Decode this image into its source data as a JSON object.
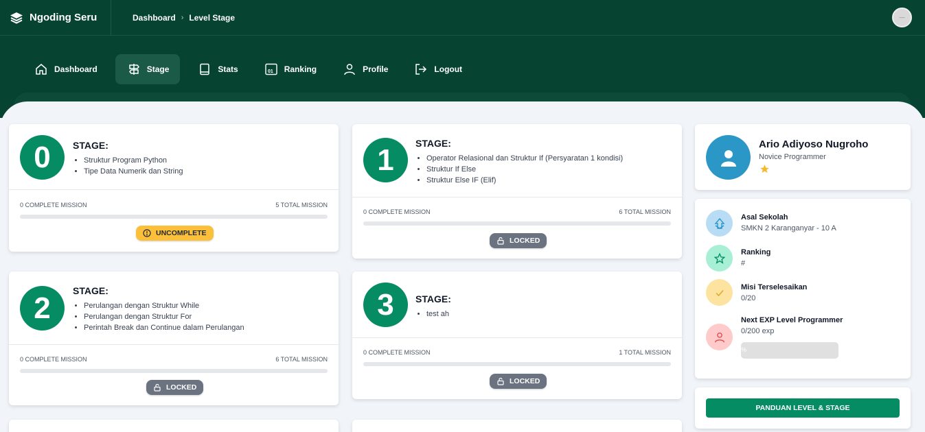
{
  "app": {
    "name": "Ngoding Seru"
  },
  "breadcrumb": {
    "items": [
      "Dashboard",
      "Level Stage"
    ],
    "separator": "›"
  },
  "nav": {
    "items": [
      {
        "label": "Dashboard",
        "icon": "home-icon"
      },
      {
        "label": "Stage",
        "icon": "signpost-icon",
        "active": true
      },
      {
        "label": "Stats",
        "icon": "book-icon"
      },
      {
        "label": "Ranking",
        "icon": "ranking-icon"
      },
      {
        "label": "Profile",
        "icon": "user-icon"
      },
      {
        "label": "Logout",
        "icon": "logout-icon"
      }
    ]
  },
  "stages": [
    {
      "number": "0",
      "title": "STAGE:",
      "topics": [
        "Struktur Program Python",
        "Tipe Data Numerik dan String"
      ],
      "complete": "0 COMPLETE MISSION",
      "total": "5 TOTAL MISSION",
      "progress": 0,
      "status": "UNCOMPLETE",
      "status_icon": "alert-circle-icon"
    },
    {
      "number": "1",
      "title": "STAGE:",
      "topics": [
        "Operator Relasional dan Struktur If (Persyaratan 1 kondisi)",
        "Struktur If Else",
        "Struktur Else IF (Elif)"
      ],
      "complete": "0 COMPLETE MISSION",
      "total": "6 TOTAL MISSION",
      "progress": 0,
      "status": "LOCKED",
      "status_icon": "lock-icon"
    },
    {
      "number": "2",
      "title": "STAGE:",
      "topics": [
        "Perulangan dengan Struktur While",
        "Perulangan dengan Struktur For",
        "Perintah Break dan Continue dalam Perulangan"
      ],
      "complete": "0 COMPLETE MISSION",
      "total": "6 TOTAL MISSION",
      "progress": 0,
      "status": "LOCKED",
      "status_icon": "lock-icon"
    },
    {
      "number": "3",
      "title": "STAGE:",
      "topics": [
        "test ah"
      ],
      "complete": "0 COMPLETE MISSION",
      "total": "1 TOTAL MISSION",
      "progress": 0,
      "status": "LOCKED",
      "status_icon": "lock-icon"
    }
  ],
  "profile": {
    "name": "Ario Adiyoso Nugroho",
    "role": "Novice Programmer",
    "stars": 1
  },
  "info": {
    "school": {
      "label": "Asal Sekolah",
      "value": "SMKN 2 Karanganyar - 10 A",
      "icon": "school-icon",
      "color": "#b9dcf5"
    },
    "ranking": {
      "label": "Ranking",
      "value": "#",
      "icon": "star-outline-icon",
      "color": "#a7f0d6"
    },
    "missions": {
      "label": "Misi Terselesaikan",
      "value": "0/20",
      "icon": "check-icon",
      "color": "#fde3a0"
    },
    "exp": {
      "label": "Next EXP Level Programmer",
      "value": "0/200 exp",
      "icon": "user-icon",
      "color": "#fecaca",
      "bar_text": "%",
      "progress": 0
    }
  },
  "guide": {
    "label": "PANDUAN LEVEL & STAGE"
  },
  "colors": {
    "header": "#064431",
    "primary": "#068c63",
    "warning": "#fbbf3a",
    "locked": "#6b7280",
    "avatar": "#2b97c6"
  }
}
